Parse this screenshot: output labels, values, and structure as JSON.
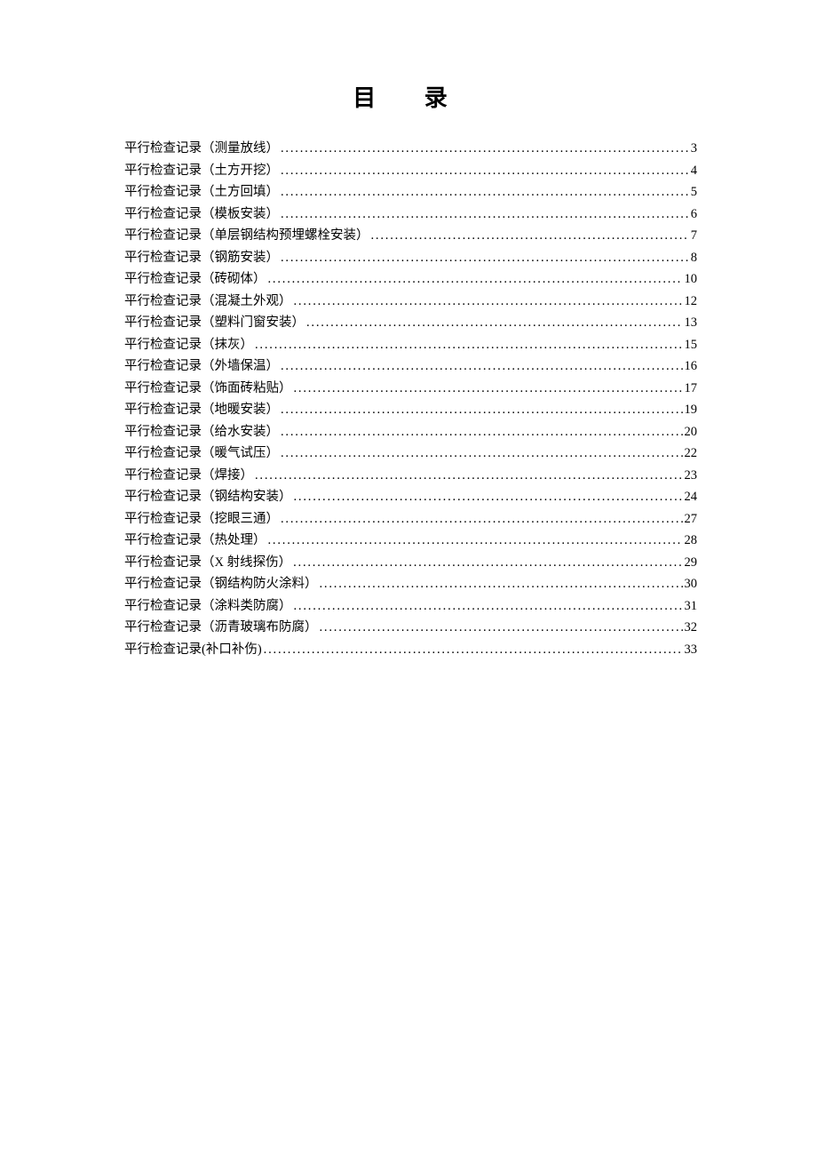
{
  "title": "目 录",
  "toc": [
    {
      "label": "平行检查记录（测量放线）",
      "page": "3"
    },
    {
      "label": "平行检查记录（土方开挖）",
      "page": "4"
    },
    {
      "label": "平行检查记录（土方回填）",
      "page": "5"
    },
    {
      "label": "平行检查记录（模板安装）",
      "page": "6"
    },
    {
      "label": "平行检查记录（单层钢结构预埋螺栓安装）",
      "page": "7"
    },
    {
      "label": "平行检查记录（钢筋安装）",
      "page": "8"
    },
    {
      "label": "平行检查记录（砖砌体）",
      "page": "10"
    },
    {
      "label": "平行检查记录（混凝土外观）",
      "page": "12"
    },
    {
      "label": "平行检查记录（塑料门窗安装）",
      "page": "13"
    },
    {
      "label": "平行检查记录（抹灰）",
      "page": "15"
    },
    {
      "label": "平行检查记录（外墙保温）",
      "page": "16"
    },
    {
      "label": "平行检查记录（饰面砖粘贴）",
      "page": "17"
    },
    {
      "label": "平行检查记录（地暖安装）",
      "page": "19"
    },
    {
      "label": "平行检查记录（给水安装）",
      "page": "20"
    },
    {
      "label": "平行检查记录（暖气试压）",
      "page": "22"
    },
    {
      "label": "平行检查记录（焊接）",
      "page": "23"
    },
    {
      "label": "平行检查记录（钢结构安装）",
      "page": "24"
    },
    {
      "label": "平行检查记录（挖眼三通）",
      "page": "27"
    },
    {
      "label": "平行检查记录（热处理）",
      "page": "28"
    },
    {
      "label": "平行检查记录（X 射线探伤）",
      "page": "29"
    },
    {
      "label": "平行检查记录（钢结构防火涂料）",
      "page": "30"
    },
    {
      "label": "平行检查记录（涂料类防腐）",
      "page": "31"
    },
    {
      "label": "平行检查记录（沥青玻璃布防腐）",
      "page": "32"
    },
    {
      "label": "平行检查记录(补口补伤)",
      "page": "33"
    }
  ]
}
